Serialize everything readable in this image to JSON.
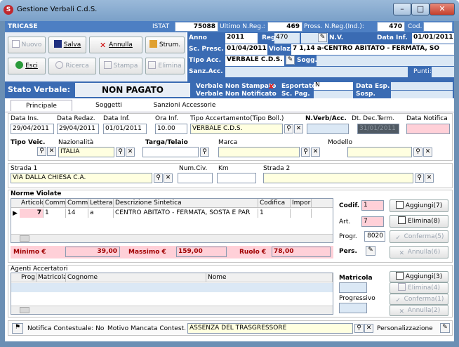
{
  "window": {
    "title": "Gestione Verbali C.d.S."
  },
  "header": {
    "tricase": "TRICASE",
    "istat_label": "ISTAT",
    "istat_value": "75088",
    "ultimo_label": "Ultimo N.Reg.:",
    "ultimo_value": "469",
    "pross_label": "Pross. N.Reg.(Ind.):",
    "pross_value": "470",
    "cod_label": "Cod."
  },
  "toolbar": {
    "nuovo": "Nuovo",
    "salva": "Salva",
    "annulla": "Annulla",
    "strum": "Strum.",
    "esci": "Esci",
    "ricerca": "Ricerca",
    "stampa": "Stampa",
    "elimina": "Elimina"
  },
  "info": {
    "anno_label": "Anno",
    "anno_value": "2011",
    "reg_label": "Reg.",
    "reg_value": "470",
    "nv_label": "N.V.",
    "data_inf_label": "Data Inf.",
    "data_inf_value": "01/01/2011",
    "sc_presc_label": "Sc. Presc.",
    "sc_presc_value": "01/04/2011",
    "violaz_label": "Violaz.",
    "violaz_value": "7 1,14 a-CENTRO ABITATO - FERMATA, SO",
    "tipo_acc_label": "Tipo Acc.",
    "tipo_acc_value": "VERBALE C.D.S.",
    "sogg_label": "Sogg.",
    "sanz_acc_label": "Sanz.Acc.",
    "punti_label": "Punti:"
  },
  "status": {
    "stato_label": "Stato Verbale:",
    "stato_value": "NON PAGATO",
    "non_stampato": "Verbale Non Stampato",
    "non_notificato": "Verbale Non Notificato",
    "esportato_label": "Esportato",
    "esportato_value": "N",
    "sc_pag_label": "Sc. Pag.",
    "data_esp_label": "Data Esp.",
    "sosp_label": "Sosp."
  },
  "tabs": [
    "Principale",
    "Soggetti",
    "Sanzioni Accessorie"
  ],
  "main": {
    "data_ins_label": "Data Ins.",
    "data_ins_value": "29/04/2011",
    "data_redaz_label": "Data Redaz.",
    "data_redaz_value": "29/04/2011",
    "data_inf_label": "Data Inf.",
    "data_inf_value": "01/01/2011",
    "ora_inf_label": "Ora Inf.",
    "ora_inf_value": "10.00",
    "tipo_acc_label": "Tipo Accertamento(Tipo Boll.)",
    "tipo_acc_value": "VERBALE C.D.S.",
    "nverb_label": "N.Verb/Acc.",
    "dt_dec_label": "Dt. Dec.Term.",
    "dt_dec_value": "31/01/2011",
    "data_notifica_label": "Data Notifica",
    "tipo_veic_label": "Tipo Veic.",
    "nazionalita_label": "Nazionalità",
    "nazionalita_value": "ITALIA",
    "targa_label": "Targa/Telaio",
    "marca_label": "Marca",
    "modello_label": "Modello",
    "strada1_label": "Strada 1",
    "strada1_value": "VIA  DALLA CHIESA C.A.",
    "num_civ_label": "Num.Civ.",
    "km_label": "Km",
    "strada2_label": "Strada 2"
  },
  "norme": {
    "section_label": "Norme Violate",
    "columns": [
      "Articolo",
      "Comma",
      "Comma",
      "Lettera",
      "Descrizione Sintetica",
      "Codifica",
      "Impor"
    ],
    "row": [
      "7",
      "1",
      "14",
      "a",
      "CENTRO ABITATO - FERMATA, SOSTA E PAR",
      "1",
      ""
    ],
    "minimo_label": "Minimo €",
    "minimo_value": "39,00",
    "massimo_label": "Massimo €",
    "massimo_value": "159,00",
    "ruolo_label": "Ruolo €",
    "ruolo_value": "78,00",
    "codif_label": "Codif.",
    "codif_value": "1",
    "art_label": "Art.",
    "art_value": "7",
    "progr_label": "Progr.",
    "progr_value": "8020",
    "pers_label": "Pers.",
    "aggiungi": "Aggiungi(7)",
    "elimina": "Elimina(8)",
    "conferma": "Conferma(5)",
    "annulla": "Annulla(6)"
  },
  "agenti": {
    "section_label": "Agenti Accertatori",
    "columns": [
      "Prog.",
      "Matricola",
      "Cognome",
      "Nome"
    ],
    "matricola_label": "Matricola",
    "progressivo_label": "Progressivo",
    "aggiungi": "Aggiungi(3)",
    "elimina": "Elimina(4)",
    "conferma": "Conferma(1)",
    "annulla": "Annulla(2)"
  },
  "footer": {
    "notifica_label": "Notifica Contestuale: No",
    "motivo_label": "Motivo Mancata Contest.",
    "motivo_value": "ASSENZA DEL TRASGRESSORE",
    "personalizzazione_label": "Personalizzazione"
  },
  "colors": {
    "accent_blue": "#4d7fc3",
    "status_red": "#c00000",
    "pink": "#ffd0d8",
    "yellow": "#ffffe0"
  }
}
